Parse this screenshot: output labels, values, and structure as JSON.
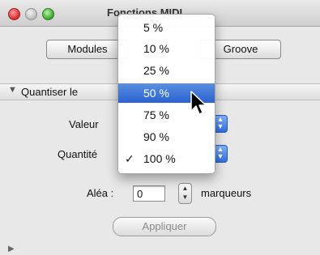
{
  "window": {
    "title": "Fonctions MIDI"
  },
  "segmented": {
    "modules_label": "Modules",
    "groove_label": "Groove"
  },
  "section": {
    "title": "Quantiser le",
    "valeur_label": "Valeur",
    "quantite_label": "Quantité",
    "alea_label": "Aléa :",
    "alea_value": "0",
    "alea_unit": "marqueurs",
    "apply_label": "Appliquer"
  },
  "menu": {
    "selected_value": "100 %",
    "highlighted_value": "50 %",
    "items": [
      "5 %",
      "10 %",
      "25 %",
      "50 %",
      "75 %",
      "90 %",
      "100 %"
    ]
  },
  "colors": {
    "highlight": "#2a62d1",
    "window_bg": "#e8e8e8"
  }
}
